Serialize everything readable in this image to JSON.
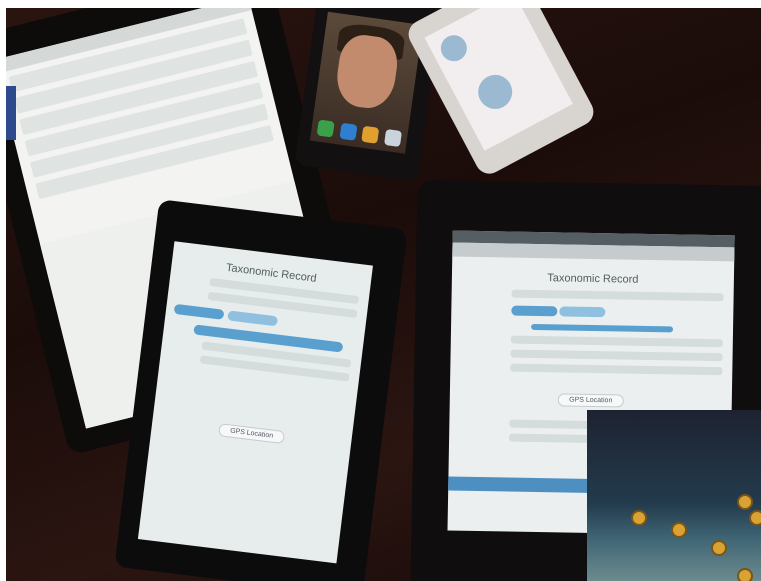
{
  "scene": {
    "tablet_center_title": "Taxonomic Record",
    "tablet_right_title": "Taxonomic Record",
    "button_label": "GPS Location",
    "accent_color": "#5aa0cf",
    "inset_marker_color": "#d9a233"
  },
  "inset": {
    "markers": [
      {
        "id": "m1"
      },
      {
        "id": "m2"
      },
      {
        "id": "m3"
      },
      {
        "id": "m4"
      },
      {
        "id": "m5"
      },
      {
        "id": "m6"
      },
      {
        "id": "m7"
      }
    ]
  }
}
